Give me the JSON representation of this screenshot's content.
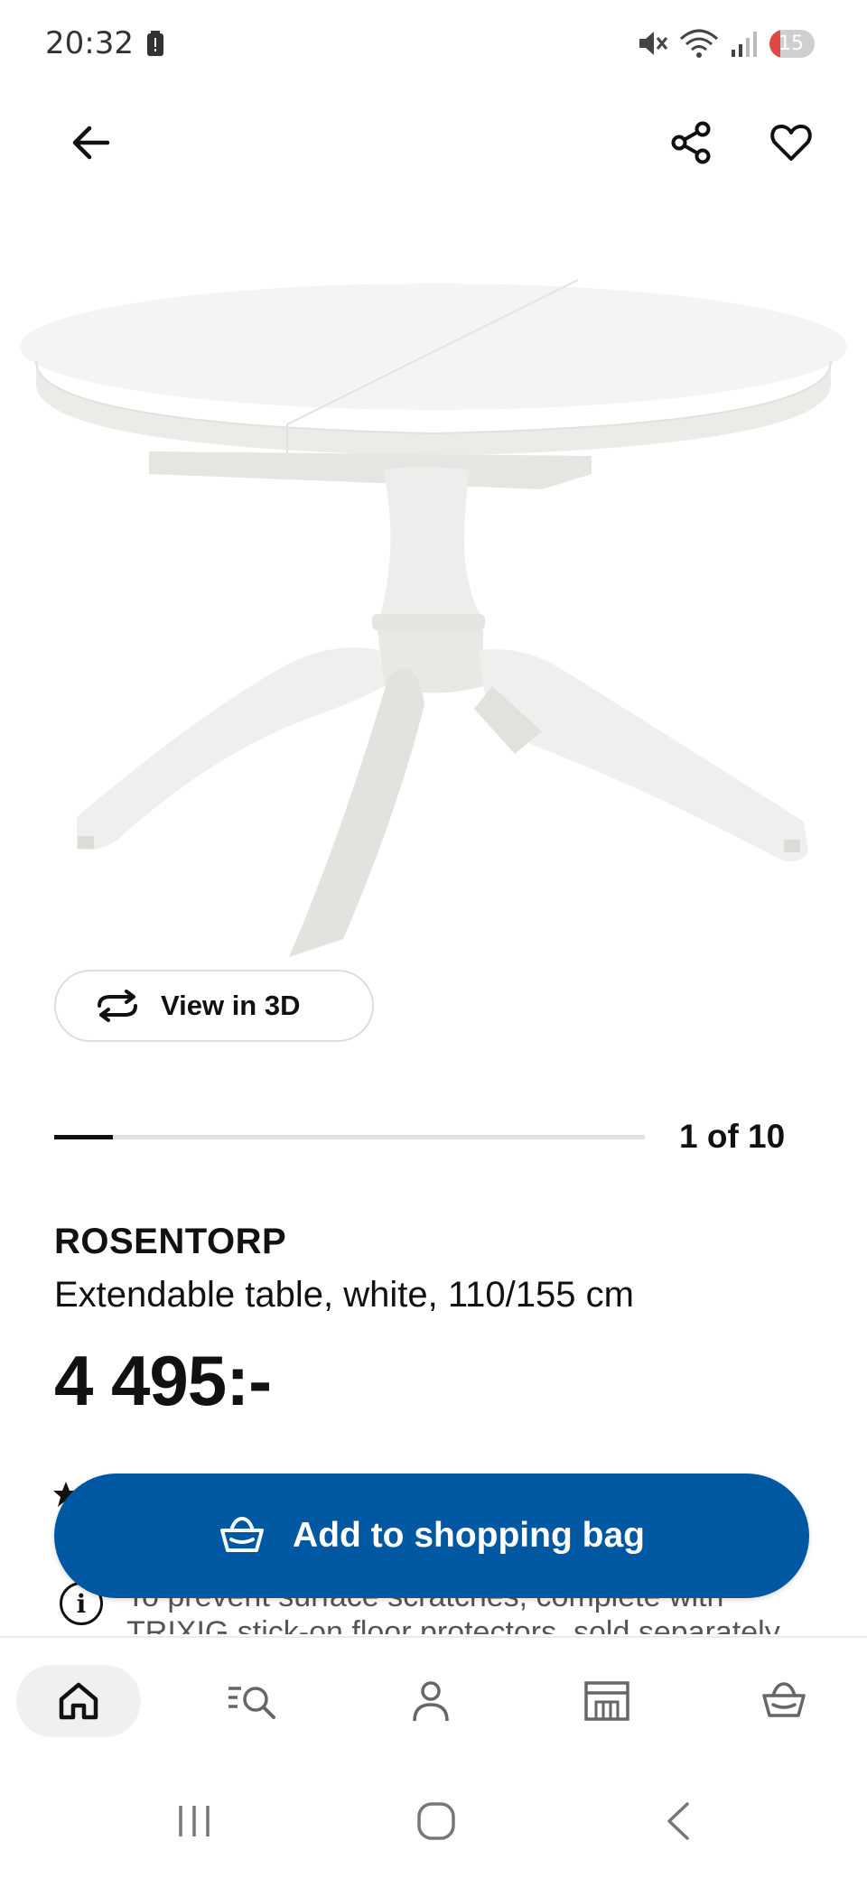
{
  "status_bar": {
    "time": "20:32",
    "battery_level": "15",
    "icons": [
      "battery-alert-icon",
      "mute-icon",
      "wifi-icon",
      "signal-icon"
    ]
  },
  "top_bar": {
    "icons": [
      "arrow-left-icon",
      "share-icon",
      "heart-icon"
    ]
  },
  "gallery": {
    "view_3d_label": "View in 3D",
    "counter": "1 of 10",
    "current_index": 1,
    "total": 10
  },
  "product": {
    "name": "ROSENTORP",
    "description": "Extendable table, white, 110/155 cm",
    "price": "4 495:-",
    "notice": "To prevent surface scratches, complete with TRIXIG stick-on floor protectors, sold separately."
  },
  "actions": {
    "add_to_bag_label": "Add to shopping bag"
  },
  "bottom_nav": {
    "items": [
      "home-icon",
      "search-list-icon",
      "profile-icon",
      "store-icon",
      "basket-icon"
    ],
    "active": "home-icon"
  },
  "system_nav": {
    "items": [
      "recents-icon",
      "home-circle-icon",
      "back-chevron-icon"
    ]
  },
  "colors": {
    "accent": "#0058a3",
    "text": "#111111",
    "battery_low": "#e04848"
  }
}
